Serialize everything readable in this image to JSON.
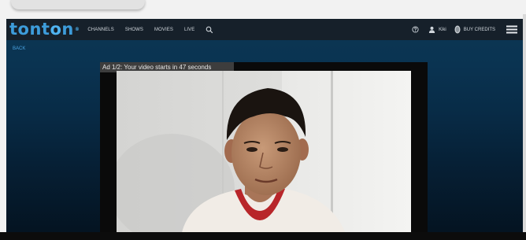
{
  "logo": {
    "text_a": "tont",
    "text_o": "o",
    "text_b": "n",
    "reg": "®"
  },
  "nav": {
    "items": [
      "CHANNELS",
      "SHOWS",
      "MOVIES",
      "LIVE"
    ]
  },
  "user": {
    "name": "Kiki"
  },
  "credits": {
    "label": "BUY CREDITS"
  },
  "back": {
    "label": "BACK"
  },
  "player": {
    "ad_text": "Ad 1/2: Your video starts in 47 seconds"
  },
  "icons": {
    "search": "search-icon",
    "help": "help-icon",
    "user": "user-icon",
    "credits": "coin-icon",
    "menu": "hamburger-menu-icon"
  },
  "colors": {
    "brand": "#3d9cda",
    "header_bg": "#16202a",
    "back_link": "#4aa3e0"
  }
}
